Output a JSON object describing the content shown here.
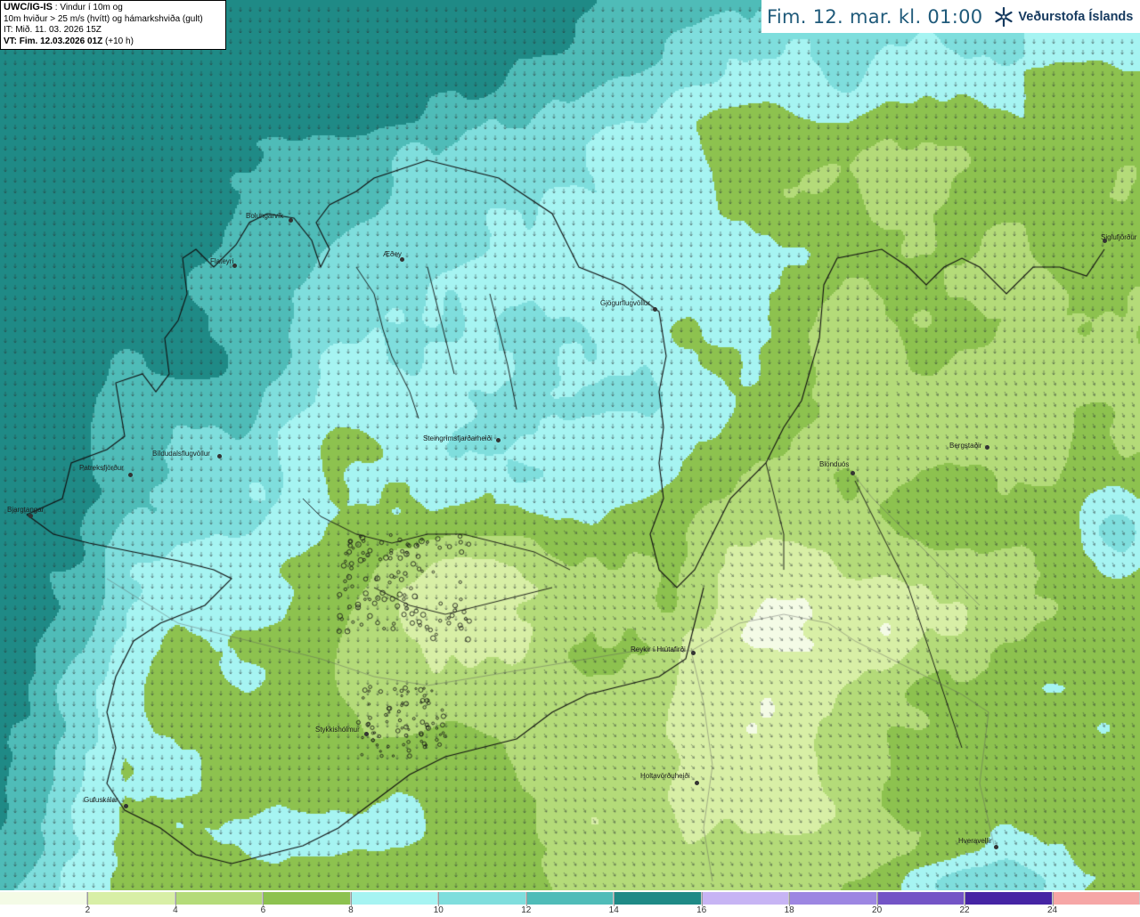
{
  "header_box": {
    "model": "UWC/IG-IS",
    "desc1": " : Vindur í 10m og",
    "desc2": "10m hviður > 25 m/s (hvítt) og hámarkshviða (gult)",
    "it": "IT: Mið. 11. 03. 2026 15Z",
    "vt": "VT: Fim. 12.03.2026 01Z",
    "vt_suffix": " (+10 h)"
  },
  "title": {
    "text": "Fim. 12. mar. kl. 01:00",
    "brand": "Veðurstofa Íslands",
    "brand_icon": "snowflake-logo-icon"
  },
  "colorbar": {
    "segments": [
      {
        "color": "#f4fbe6"
      },
      {
        "color": "#d8efa6"
      },
      {
        "color": "#b4db79"
      },
      {
        "color": "#8dc24f"
      },
      {
        "color": "#a6f4f2"
      },
      {
        "color": "#7fdedd"
      },
      {
        "color": "#4fbcb8"
      },
      {
        "color": "#1f8a86"
      },
      {
        "color": "#c7b4f4"
      },
      {
        "color": "#9d86e2"
      },
      {
        "color": "#7454c6"
      },
      {
        "color": "#4624a4"
      },
      {
        "color": "#f6a6a6"
      }
    ],
    "labels": [
      "2",
      "4",
      "6",
      "8",
      "10",
      "12",
      "14",
      "16",
      "18",
      "20",
      "22",
      "24"
    ]
  },
  "places": [
    {
      "name": "Bolungarvík"
    },
    {
      "name": "Æðey"
    },
    {
      "name": "Flateyri"
    },
    {
      "name": "Gjögurflugvöllur"
    },
    {
      "name": "Siglufjörður"
    },
    {
      "name": "Bíldudalsflugvöllur"
    },
    {
      "name": "Patreksfjörður"
    },
    {
      "name": "Bjargtangar"
    },
    {
      "name": "Steingrímsfjarðarheiði"
    },
    {
      "name": "Blönduós"
    },
    {
      "name": "Bergstaðir"
    },
    {
      "name": "Reykir í Hrútafirði"
    },
    {
      "name": "Stykkishólmur"
    },
    {
      "name": "Holtavörðuheiði"
    },
    {
      "name": "Gufuskálar"
    },
    {
      "name": "Hveravellir"
    }
  ]
}
